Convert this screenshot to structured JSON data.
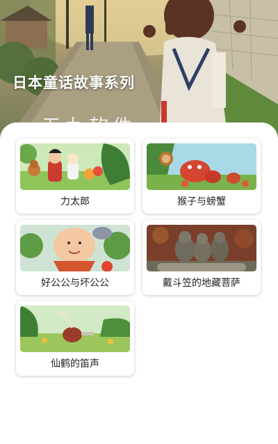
{
  "hero": {
    "title": "日本童话故事系列",
    "watermark": "五九软件"
  },
  "stories": [
    {
      "title": "力太郎",
      "image": "boy-with-animals-illustration"
    },
    {
      "title": "猴子与螃蟹",
      "image": "monkeys-and-crabs-illustration"
    },
    {
      "title": "好公公与坏公公",
      "image": "old-man-with-dog-illustration"
    },
    {
      "title": "戴斗笠的地藏菩萨",
      "image": "jizo-stone-statues-photo"
    },
    {
      "title": "仙鹤的笛声",
      "image": "crane-in-field-illustration"
    }
  ]
}
